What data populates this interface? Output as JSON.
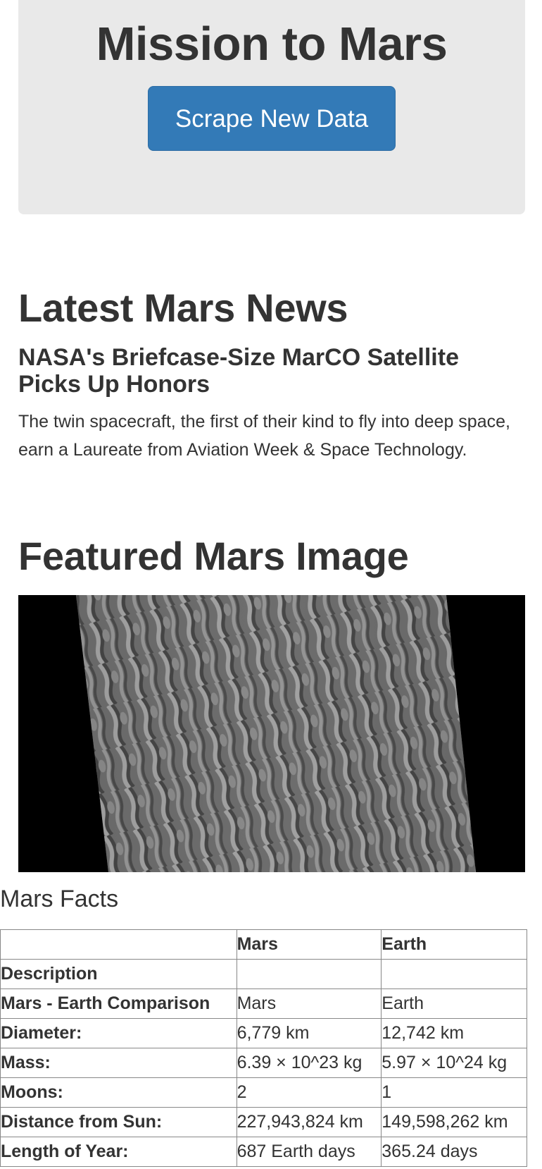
{
  "header": {
    "title": "Mission to Mars",
    "scrape_button_label": "Scrape New Data"
  },
  "news": {
    "section_title": "Latest Mars News",
    "headline": "NASA's Briefcase-Size MarCO Satellite Picks Up Honors",
    "teaser": "The twin spacecraft, the first of their kind to fly into deep space, earn a Laureate from Aviation Week & Space Technology."
  },
  "featured": {
    "section_title": "Featured Mars Image"
  },
  "facts": {
    "section_title": "Mars Facts",
    "columns": [
      "",
      "Mars",
      "Earth"
    ],
    "rows": [
      {
        "label": "Description",
        "mars": "",
        "earth": ""
      },
      {
        "label": "Mars - Earth Comparison",
        "mars": "Mars",
        "earth": "Earth"
      },
      {
        "label": "Diameter:",
        "mars": "6,779 km",
        "earth": "12,742 km"
      },
      {
        "label": "Mass:",
        "mars": "6.39 × 10^23 kg",
        "earth": "5.97 × 10^24 kg"
      },
      {
        "label": "Moons:",
        "mars": "2",
        "earth": "1"
      },
      {
        "label": "Distance from Sun:",
        "mars": "227,943,824 km",
        "earth": "149,598,262 km"
      },
      {
        "label": "Length of Year:",
        "mars": "687 Earth days",
        "earth": "365.24 days"
      }
    ]
  }
}
